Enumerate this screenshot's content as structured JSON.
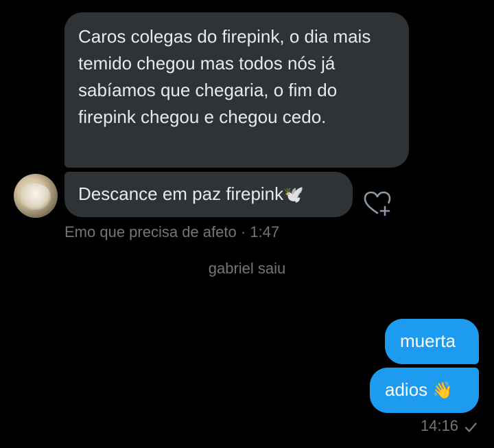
{
  "conversation": {
    "incoming": [
      {
        "text": "Caros colegas do firepink, o dia mais temido chegou mas todos nós já sabíamos que chegaria, o fim do firepink chegou e chegou cedo."
      },
      {
        "text": "Descance em paz firepink",
        "emoji": "🕊️",
        "emoji_icon": "dove-icon"
      }
    ],
    "sender_meta": "Emo que precisa de afeto · 1:47",
    "react_icon": "heart-plus-icon",
    "system_event": "gabriel saiu",
    "outgoing": [
      {
        "text": "muerta"
      },
      {
        "text": "adios",
        "emoji": "👋",
        "emoji_icon": "waving-hand-icon"
      }
    ],
    "outgoing_time": "14:16",
    "status_icon": "check-icon"
  },
  "colors": {
    "background": "#000000",
    "incoming_bubble": "#2f3336",
    "outgoing_bubble": "#1d9bf0",
    "meta_text": "#71767b"
  }
}
